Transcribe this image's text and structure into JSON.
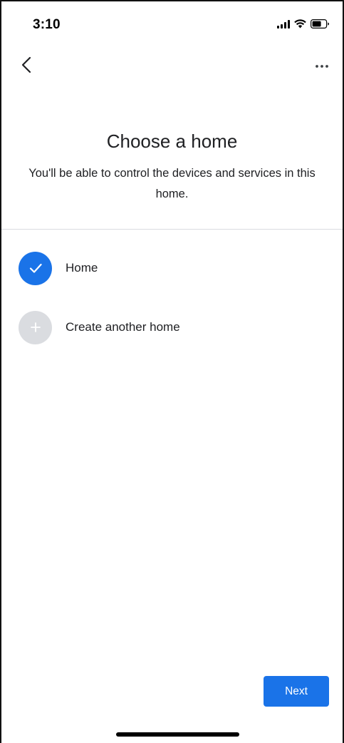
{
  "status_bar": {
    "time": "3:10",
    "icons": [
      "signal-icon",
      "wifi-icon",
      "battery-icon"
    ]
  },
  "nav": {
    "back_icon": "chevron-left-icon",
    "more_icon": "more-horizontal-icon"
  },
  "header": {
    "title": "Choose a home",
    "subtitle": "You'll be able to control the devices and services in this home."
  },
  "homes": [
    {
      "label": "Home",
      "icon": "check-icon",
      "selected": true
    },
    {
      "label": "Create another home",
      "icon": "plus-icon",
      "selected": false
    }
  ],
  "actions": {
    "next_label": "Next"
  },
  "colors": {
    "accent": "#1a73e8",
    "text": "#202124",
    "divider": "#dadce0",
    "add_circle": "#dadce0"
  }
}
